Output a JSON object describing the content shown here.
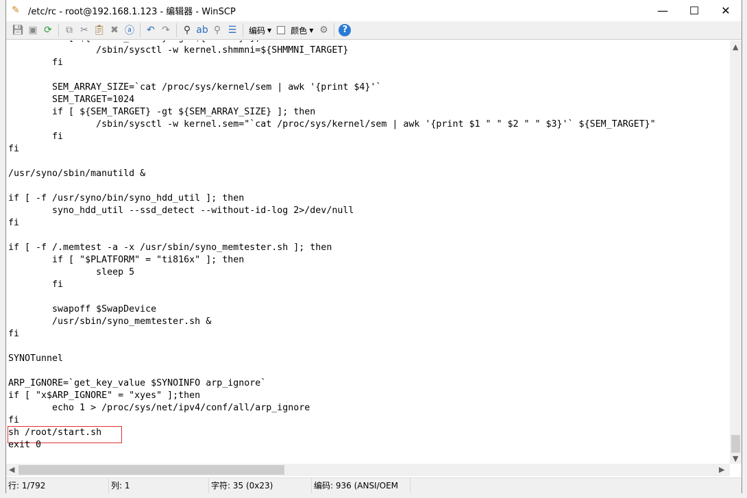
{
  "window": {
    "title": "/etc/rc - root@192.168.1.123 - 编辑器 - WinSCP"
  },
  "toolbar": {
    "encoding_label": "编码",
    "color_label": "颜色"
  },
  "editor": {
    "lines": [
      "        if [ ${SHMMNI_TARGET} -gt ${SHMMNI} ]; then",
      "                /sbin/sysctl -w kernel.shmmni=${SHMMNI_TARGET}",
      "        fi",
      "",
      "        SEM_ARRAY_SIZE=`cat /proc/sys/kernel/sem | awk '{print $4}'`",
      "        SEM_TARGET=1024",
      "        if [ ${SEM_TARGET} -gt ${SEM_ARRAY_SIZE} ]; then",
      "                /sbin/sysctl -w kernel.sem=\"`cat /proc/sys/kernel/sem | awk '{print $1 \" \" $2 \" \" $3}'` ${SEM_TARGET}\"",
      "        fi",
      "fi",
      "",
      "/usr/syno/sbin/manutild &",
      "",
      "if [ -f /usr/syno/bin/syno_hdd_util ]; then",
      "        syno_hdd_util --ssd_detect --without-id-log 2>/dev/null",
      "fi",
      "",
      "if [ -f /.memtest -a -x /usr/sbin/syno_memtester.sh ]; then",
      "        if [ \"$PLATFORM\" = \"ti816x\" ]; then",
      "                sleep 5",
      "        fi",
      "",
      "        swapoff $SwapDevice",
      "        /usr/sbin/syno_memtester.sh &",
      "fi",
      "",
      "SYNOTunnel",
      "",
      "ARP_IGNORE=`get_key_value $SYNOINFO arp_ignore`",
      "if [ \"x$ARP_IGNORE\" = \"xyes\" ];then",
      "        echo 1 > /proc/sys/net/ipv4/conf/all/arp_ignore",
      "fi",
      "sh /root/start.sh",
      "exit 0"
    ]
  },
  "status": {
    "line": "行: 1/792",
    "col": "列: 1",
    "char": "字符: 35 (0x23)",
    "encoding": "编码: 936   (ANSI/OEM"
  }
}
